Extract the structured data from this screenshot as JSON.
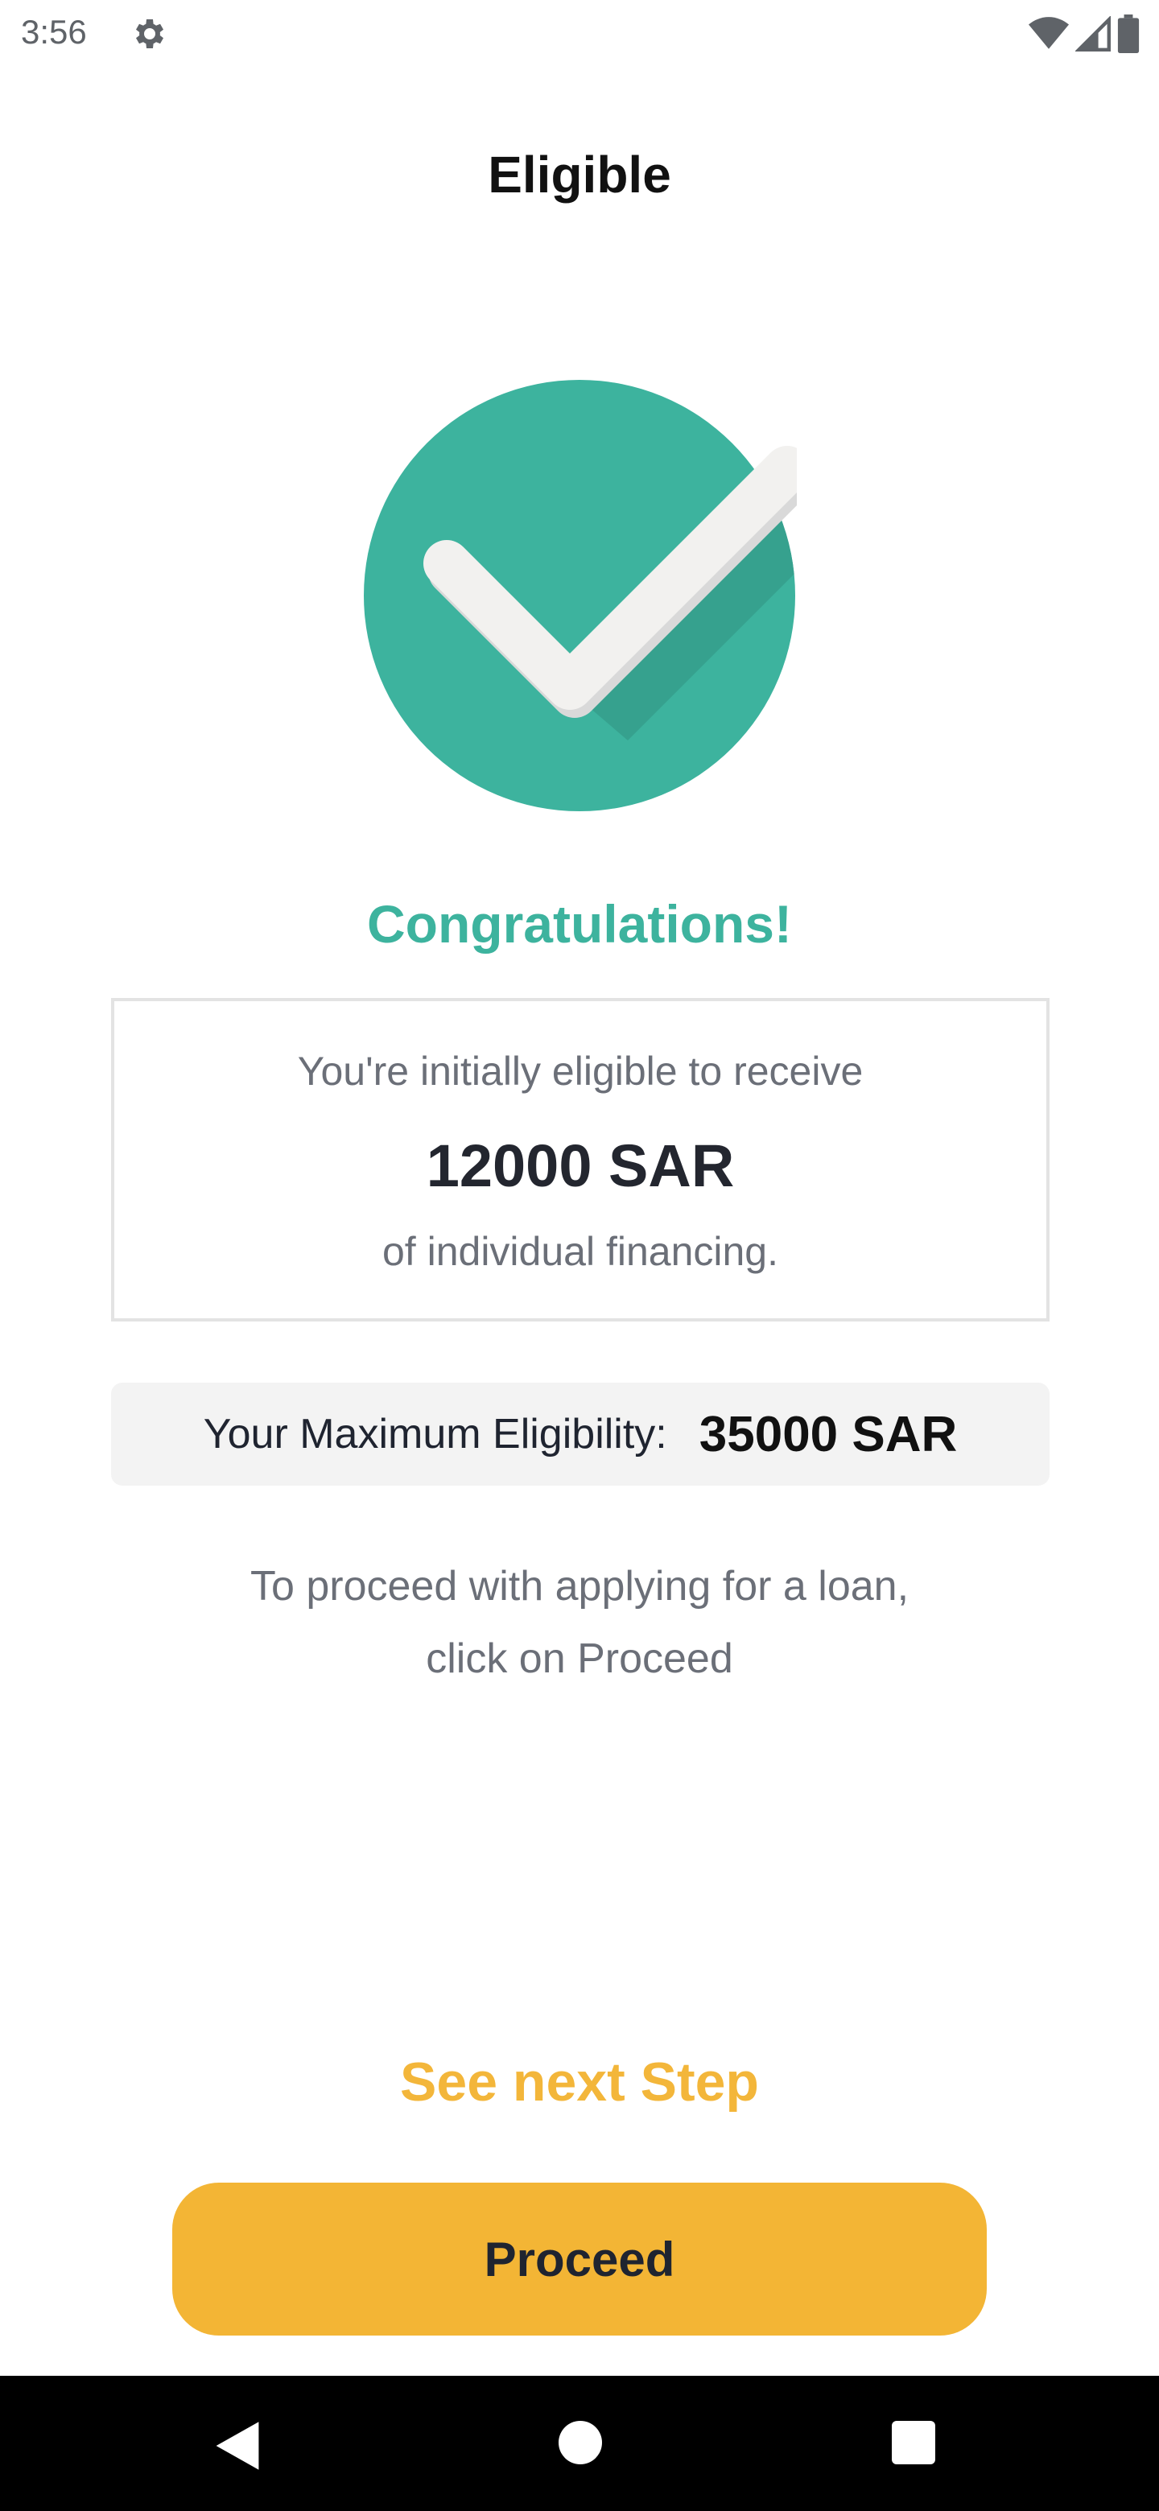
{
  "status_bar": {
    "time": "3:56",
    "icons": [
      "gear-icon",
      "wifi-icon",
      "signal-icon",
      "battery-icon"
    ]
  },
  "header": {
    "title": "Eligible"
  },
  "success": {
    "icon": "check-circle-icon",
    "heading": "Congratulations!"
  },
  "eligibility_card": {
    "line1": "You're initially eligible to receive",
    "amount": "12000 SAR",
    "line2": "of individual financing."
  },
  "max_eligibility": {
    "label": "Your Maximum Eligibility:",
    "value": "35000 SAR"
  },
  "instruction": {
    "line1": "To proceed with applying for a loan,",
    "line2": "click on Proceed"
  },
  "actions": {
    "next_step": "See next Step",
    "proceed": "Proceed"
  },
  "nav_bar": {
    "icons": [
      "back-icon",
      "home-icon",
      "recents-icon"
    ]
  },
  "colors": {
    "accent_green": "#3db39e",
    "accent_yellow": "#f3b535",
    "text_muted": "#6b6f78"
  }
}
